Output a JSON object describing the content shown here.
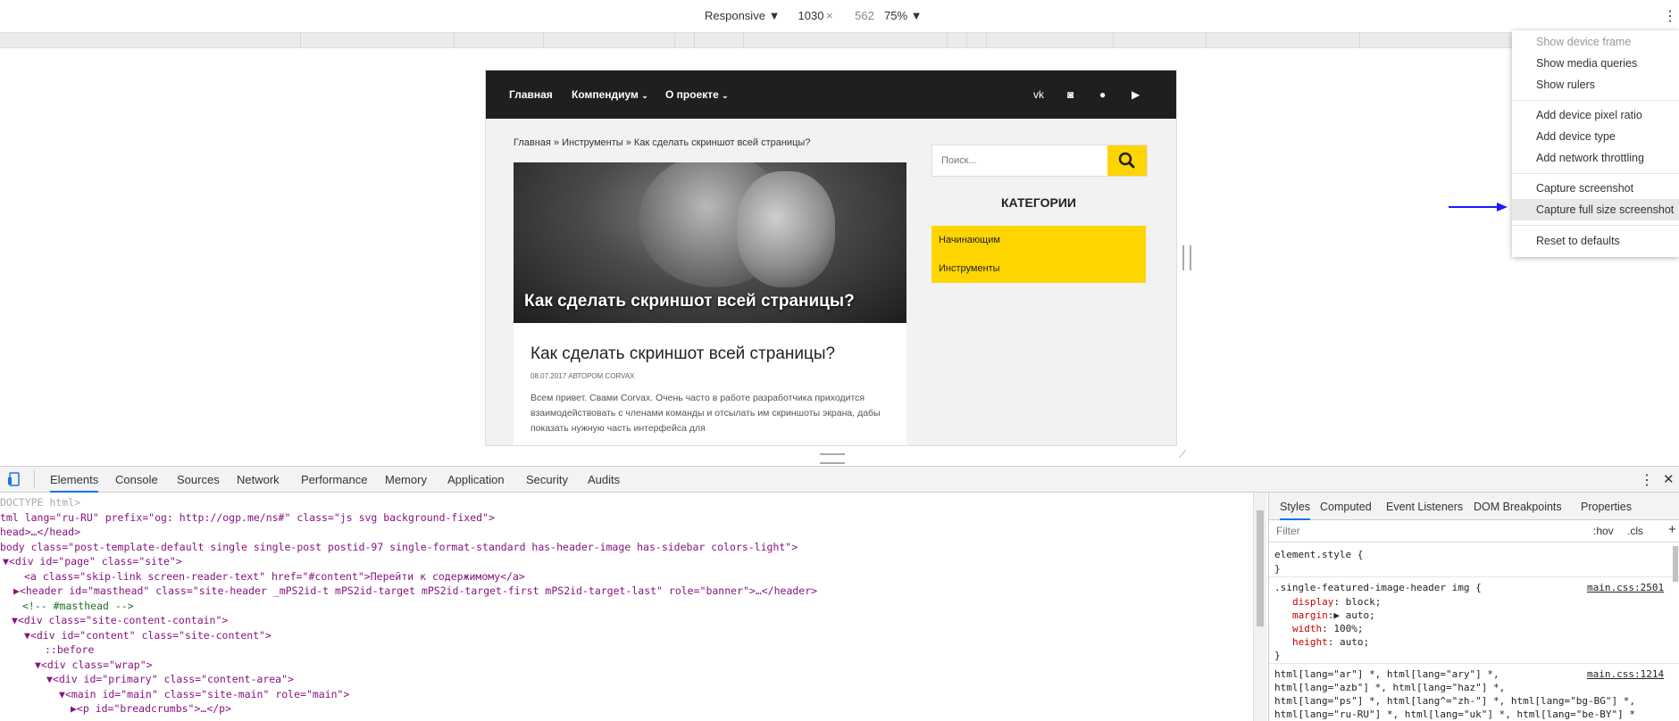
{
  "device_toolbar": {
    "mode": "Responsive",
    "width": "1030",
    "times": "×",
    "height": "562",
    "zoom": "75%",
    "more_icon": "vertical-dots-icon"
  },
  "site": {
    "nav": [
      "Главная",
      "Компендиум",
      "О проекте"
    ],
    "social_icons": [
      "vk-icon",
      "instagram-icon",
      "github-icon",
      "youtube-icon"
    ],
    "social_glyphs": [
      "vk",
      "◙",
      "●",
      "▶"
    ],
    "breadcrumbs": "Главная » Инструменты » Как сделать скриншот всей страницы?",
    "hero_caption": "Как сделать скриншот всей страницы?",
    "article_title": "Как сделать скриншот всей страницы?",
    "article_meta": "08.07.2017 АВТОРОМ CORVAX",
    "article_text": "Всем привет. Свами Corvax. Очень часто в работе разработчика приходится взаимодействовать с членами команды и отсылать им скриншоты экрана, дабы показать нужную часть интерфейса для",
    "search_placeholder": "Поиск...",
    "categories_heading": "КАТЕГОРИИ",
    "categories": [
      "Начинающим",
      "Инструменты"
    ]
  },
  "menu": {
    "items": [
      {
        "label": "Show device frame",
        "disabled": true
      },
      {
        "label": "Show media queries"
      },
      {
        "label": "Show rulers"
      },
      {
        "label": "Add device pixel ratio"
      },
      {
        "label": "Add device type"
      },
      {
        "label": "Add network throttling"
      },
      {
        "label": "Capture screenshot"
      },
      {
        "label": "Capture full size screenshot",
        "highlighted": true
      },
      {
        "label": "Reset to defaults"
      }
    ],
    "arrow_color": "#1a1aff"
  },
  "devtools": {
    "tabs": [
      "Elements",
      "Console",
      "Sources",
      "Network",
      "Performance",
      "Memory",
      "Application",
      "Security",
      "Audits"
    ],
    "active_tab": "Elements",
    "styles_tabs": [
      "Styles",
      "Computed",
      "Event Listeners",
      "DOM Breakpoints",
      "Properties"
    ],
    "filter_placeholder": "Filter",
    "hov": ":hov",
    "cls": ".cls",
    "plus": "+",
    "close": "✕",
    "element_style": "element.style {",
    "close_brace": "}",
    "rule_selector": ".single-featured-image-header img {",
    "rule_source": "main.css:2501",
    "rule_props": [
      {
        "name": "display",
        "value": "block;"
      },
      {
        "name": "margin",
        "value": "▶ auto;"
      },
      {
        "name": "width",
        "value": "100%;"
      },
      {
        "name": "height",
        "value": "auto;"
      }
    ],
    "rule2_lines": [
      "html[lang=\"ar\"] *, html[lang=\"ary\"] *,",
      "html[lang=\"azb\"] *, html[lang=\"haz\"] *,",
      "html[lang=\"ps\"] *, html[lang^=\"zh-\"] *, html[lang=\"bg-BG\"] *,",
      "html[lang=\"ru-RU\"] *, html[lang=\"uk\"] *, html[lang=\"be-BY\"] *"
    ],
    "rule2_source": "main.css:1214",
    "dom_lines": [
      {
        "indent": 0,
        "text": "DOCTYPE html>",
        "kind": "doc"
      },
      {
        "indent": 0,
        "text": "tml lang=\"ru-RU\" prefix=\"og: http://ogp.me/ns#\" class=\"js svg background-fixed\">",
        "kind": "tag"
      },
      {
        "indent": 0,
        "text": "head>…</head>",
        "kind": "tag"
      },
      {
        "indent": 0,
        "text": "body class=\"post-template-default single single-post postid-97 single-format-standard has-header-image has-sidebar colors-light\">",
        "kind": "tag"
      },
      {
        "indent": 1,
        "text": "▼<div id=\"page\" class=\"site\">",
        "kind": "tag"
      },
      {
        "indent": 2,
        "text": "<a class=\"skip-link screen-reader-text\" href=\"#content\">Перейти к содержимому</a>",
        "kind": "tag"
      },
      {
        "indent": 2,
        "text": "▶<header id=\"masthead\" class=\"site-header _mPS2id-t mPS2id-target mPS2id-target-first mPS2id-target-last\" role=\"banner\">…</header>",
        "kind": "tag"
      },
      {
        "indent": 2,
        "text": "<!-- #masthead -->",
        "kind": "cm"
      },
      {
        "indent": 2,
        "text": "▼<div class=\"site-content-contain\">",
        "kind": "tag"
      },
      {
        "indent": 3,
        "text": "▼<div id=\"content\" class=\"site-content\">",
        "kind": "tag"
      },
      {
        "indent": 4,
        "text": "::before",
        "kind": "pseudo"
      },
      {
        "indent": 4,
        "text": "▼<div class=\"wrap\">",
        "kind": "tag"
      },
      {
        "indent": 5,
        "text": "▼<div id=\"primary\" class=\"content-area\">",
        "kind": "tag"
      },
      {
        "indent": 6,
        "text": "▼<main id=\"main\" class=\"site-main\" role=\"main\">",
        "kind": "tag"
      },
      {
        "indent": 7,
        "text": "▶<p id=\"breadcrumbs\">…</p>",
        "kind": "tag"
      }
    ]
  }
}
